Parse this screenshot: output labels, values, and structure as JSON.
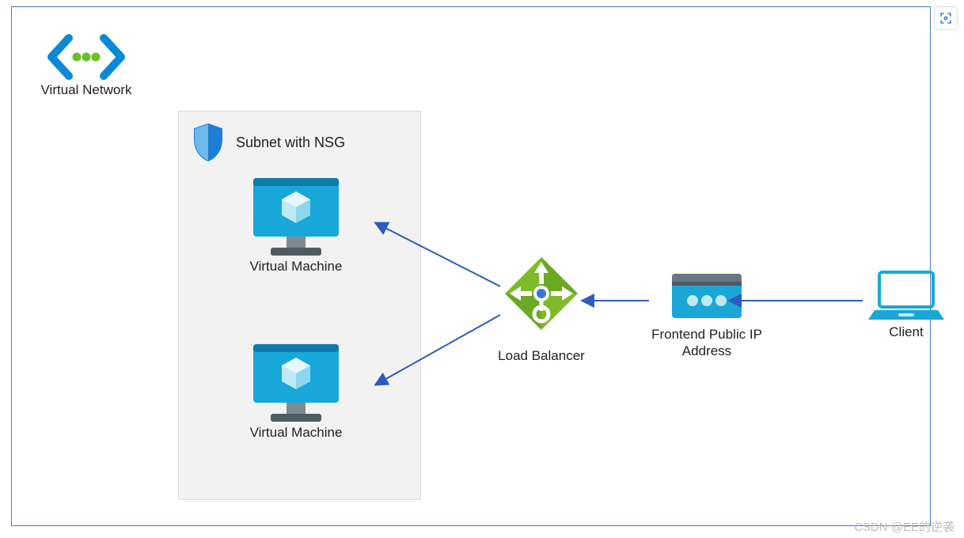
{
  "virtual_network": {
    "label": "Virtual Network"
  },
  "subnet": {
    "title": "Subnet with NSG"
  },
  "vm1": {
    "label": "Virtual Machine"
  },
  "vm2": {
    "label": "Virtual Machine"
  },
  "load_balancer": {
    "label": "Load Balancer"
  },
  "frontend_ip": {
    "label_line1": "Frontend Public IP",
    "label_line2": "Address"
  },
  "client": {
    "label": "Client"
  },
  "watermark": "CSDN @EE的逆袭",
  "diagram": {
    "flow": "Client → Frontend Public IP Address → Load Balancer → (Virtual Machine, Virtual Machine)",
    "containers": [
      {
        "name": "Virtual Network",
        "contains": [
          "Subnet with NSG"
        ]
      },
      {
        "name": "Subnet with NSG",
        "contains": [
          "Virtual Machine",
          "Virtual Machine"
        ]
      }
    ],
    "edges": [
      {
        "from": "Client",
        "to": "Frontend Public IP Address"
      },
      {
        "from": "Frontend Public IP Address",
        "to": "Load Balancer"
      },
      {
        "from": "Load Balancer",
        "to": "Virtual Machine (top)"
      },
      {
        "from": "Load Balancer",
        "to": "Virtual Machine (bottom)"
      }
    ]
  }
}
